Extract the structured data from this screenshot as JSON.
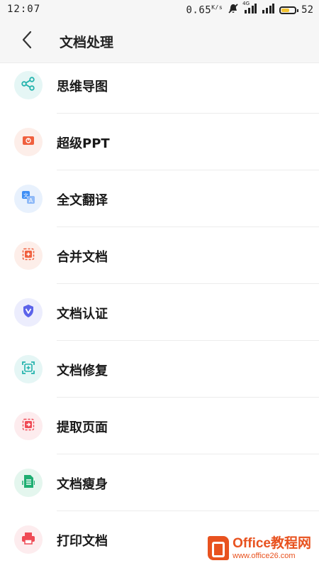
{
  "status_bar": {
    "time": "12:07",
    "speed": "0.65",
    "speed_unit": "K/s",
    "network": "4G",
    "battery": "52"
  },
  "header": {
    "title": "文档处理"
  },
  "items": [
    {
      "label": "思维导图",
      "icon": "share-nodes-icon",
      "color": "#24b3ad",
      "bg": "#e5f6f5"
    },
    {
      "label": "超级PPT",
      "icon": "presentation-icon",
      "color": "#f0603e",
      "bg": "#fdeee9"
    },
    {
      "label": "全文翻译",
      "icon": "translate-icon",
      "color": "#3e8ef5",
      "bg": "#e8f1fd"
    },
    {
      "label": "合并文档",
      "icon": "merge-document-icon",
      "color": "#f0603e",
      "bg": "#fdeee9"
    },
    {
      "label": "文档认证",
      "icon": "shield-v-icon",
      "color": "#5b63ea",
      "bg": "#ecedfd"
    },
    {
      "label": "文档修复",
      "icon": "repair-frame-icon",
      "color": "#24b3ad",
      "bg": "#e5f6f5"
    },
    {
      "label": "提取页面",
      "icon": "extract-page-icon",
      "color": "#ef4a55",
      "bg": "#fdecee"
    },
    {
      "label": "文档瘦身",
      "icon": "slim-document-icon",
      "color": "#1fae72",
      "bg": "#e4f6ee"
    },
    {
      "label": "打印文档",
      "icon": "printer-icon",
      "color": "#ef4a55",
      "bg": "#fdecee"
    }
  ],
  "watermark": {
    "title": "Office教程网",
    "url": "www.office26.com"
  }
}
